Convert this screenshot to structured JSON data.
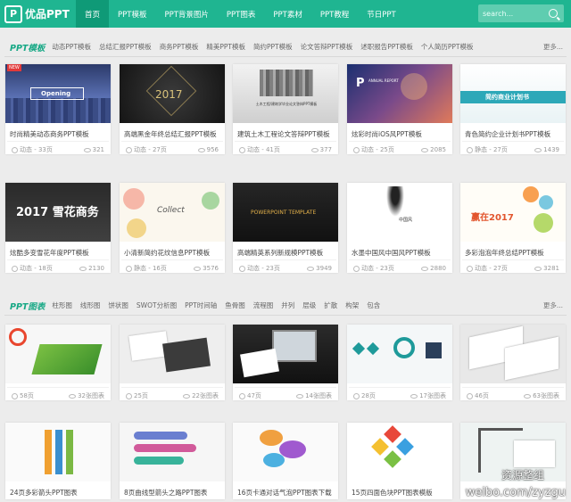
{
  "header": {
    "logo_mark": "P",
    "logo_text": "优品PPT",
    "nav": [
      "首页",
      "PPT模板",
      "PPT背景图片",
      "PPT图表",
      "PPT素材",
      "PPT教程",
      "节日PPT"
    ],
    "active_index": 0,
    "search_placeholder": "search..."
  },
  "section1": {
    "title": "PPT模板",
    "categories": [
      "动态PPT模板",
      "总结汇报PPT模板",
      "商务PPT模板",
      "精美PPT模板",
      "简约PPT模板",
      "论文答辩PPT模板",
      "述职报告PPT模板",
      "个人简历PPT模板"
    ],
    "more": "更多..."
  },
  "section2": {
    "title": "PPT图表",
    "categories": [
      "柱形图",
      "线形图",
      "饼状图",
      "SWOT分析图",
      "PPT时间轴",
      "鱼骨图",
      "流程图",
      "并列",
      "层级",
      "扩散",
      "构架",
      "包含"
    ],
    "more": "更多..."
  },
  "templates": [
    {
      "title": "时尚精美动态商务PPT模板",
      "pages": "动态 - 33页",
      "views": "321",
      "badge": "NEW",
      "thumb_text": "Opening"
    },
    {
      "title": "高端黑金年终总结汇报PPT模板",
      "pages": "动态 - 27页",
      "views": "956",
      "thumb_text": "2017"
    },
    {
      "title": "建筑土木工程论文答辩PPT模板",
      "pages": "动态 - 41页",
      "views": "377",
      "thumb_text": "土木工程/建筑学毕业论文答辩PPT模板"
    },
    {
      "title": "炫彩时尚iOS风PPT模板",
      "pages": "动态 - 25页",
      "views": "2085",
      "thumb_text": "ANNUAL REPORT"
    },
    {
      "title": "青色简约企业计划书PPT模板",
      "pages": "静态 - 27页",
      "views": "1439",
      "thumb_text": "简约商业计划书"
    },
    {
      "title": "炫酷多变雪花年度PPT模板",
      "pages": "动态 - 18页",
      "views": "2130",
      "thumb_text": "2017 雪花商务"
    },
    {
      "title": "小清新简约花纹信息PPT模板",
      "pages": "静态 - 16页",
      "views": "3576",
      "thumb_text": "Collect"
    },
    {
      "title": "高端精英系列新规模PPT模板",
      "pages": "动态 - 23页",
      "views": "3949",
      "thumb_text": "POWERPOINT TEMPLATE"
    },
    {
      "title": "水墨中国风中国风PPT模板",
      "pages": "动态 - 23页",
      "views": "2880",
      "thumb_text": "中国风"
    },
    {
      "title": "多彩泡泡年终总结PPT模板",
      "pages": "动态 - 27页",
      "views": "3281",
      "thumb_text": "赢在2017"
    }
  ],
  "charts": [
    {
      "title": "",
      "pages": "58页",
      "views": "32张图表"
    },
    {
      "title": "",
      "pages": "25页",
      "views": "22张图表"
    },
    {
      "title": "",
      "pages": "47页",
      "views": "14张图表"
    },
    {
      "title": "",
      "pages": "28页",
      "views": "17张图表"
    },
    {
      "title": "",
      "pages": "46页",
      "views": "63张图表"
    },
    {
      "title": "24页多彩箭头PPT图表",
      "pages": "",
      "views": ""
    },
    {
      "title": "8页曲线型箭头之路PPT图表",
      "pages": "",
      "views": ""
    },
    {
      "title": "16页卡通对话气泡PPT图表下载",
      "pages": "",
      "views": ""
    },
    {
      "title": "15页四面色块PPT图表模版",
      "pages": "",
      "views": ""
    },
    {
      "title": "",
      "pages": "",
      "views": ""
    }
  ],
  "watermark": {
    "line1": "资源整组",
    "line2": "weibo.com/zyzgu"
  },
  "colors": {
    "brand": "#1fb591",
    "brand_dark": "#0f9a77"
  }
}
